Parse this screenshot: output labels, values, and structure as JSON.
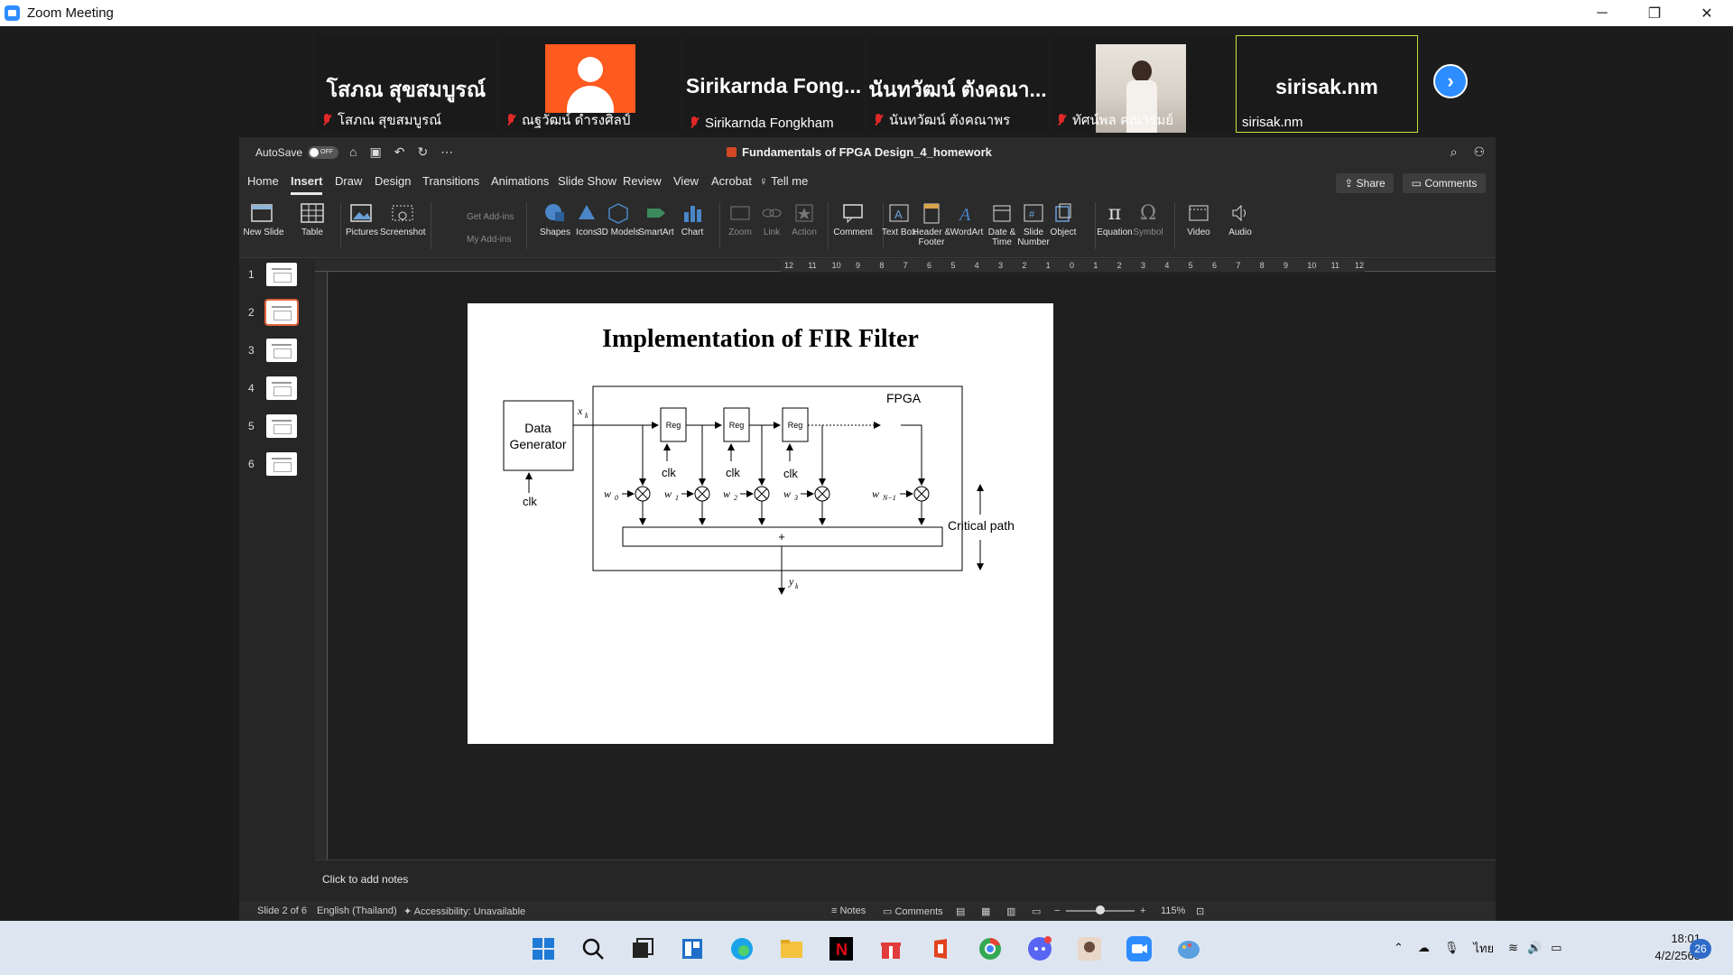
{
  "window": {
    "title": "Zoom Meeting",
    "controls": [
      "─",
      "❐",
      "✕"
    ]
  },
  "participants": [
    {
      "big_name": "โสภณ สุขสมบูรณ์",
      "caption": "โสภณ สุขสมบูรณ์",
      "muted": true,
      "kind": "name"
    },
    {
      "big_name": "",
      "caption": "ณฐวัฒน์ ดำรงศิลป์",
      "muted": true,
      "kind": "avatar"
    },
    {
      "big_name": "Sirikarnda Fong...",
      "caption": "Sirikarnda Fongkham",
      "muted": true,
      "kind": "name"
    },
    {
      "big_name": "นันทวัฒน์ ตังคณา...",
      "caption": "นันทวัฒน์ ตังคณาพร",
      "muted": true,
      "kind": "name"
    },
    {
      "big_name": "",
      "caption": "ทัศน์พล คณารมย์",
      "muted": true,
      "kind": "photo"
    },
    {
      "big_name": "sirisak.nm",
      "caption": "sirisak.nm",
      "muted": false,
      "kind": "name",
      "active": true
    }
  ],
  "ppt": {
    "autosave_label": "AutoSave",
    "autosave_state": "OFF",
    "doc_title": "Fundamentals of FPGA Design_4_homework",
    "tabs": [
      "Home",
      "Insert",
      "Draw",
      "Design",
      "Transitions",
      "Animations",
      "Slide Show",
      "Review",
      "View",
      "Acrobat",
      "Tell me"
    ],
    "active_tab": "Insert",
    "share_label": "Share",
    "comments_label": "Comments",
    "ribbon": {
      "new_slide": "New Slide",
      "table": "Table",
      "pictures": "Pictures",
      "screenshot": "Screenshot",
      "get_addins": "Get Add-ins",
      "my_addins": "My Add-ins",
      "shapes": "Shapes",
      "icons": "Icons",
      "models": "3D Models",
      "smartart": "SmartArt",
      "chart": "Chart",
      "zoom": "Zoom",
      "link": "Link",
      "action": "Action",
      "comment": "Comment",
      "textbox": "Text Box",
      "header_footer": "Header & Footer",
      "wordart": "WordArt",
      "date_time": "Date & Time",
      "slide_number": "Slide Number",
      "object": "Object",
      "equation": "Equation",
      "symbol": "Symbol",
      "video": "Video",
      "audio": "Audio"
    },
    "slides": [
      "1",
      "2",
      "3",
      "4",
      "5",
      "6"
    ],
    "selected_slide": "2",
    "ruler_top": [
      "12",
      "11",
      "10",
      "9",
      "8",
      "7",
      "6",
      "5",
      "4",
      "3",
      "2",
      "1",
      "0",
      "1",
      "2",
      "3",
      "4",
      "5",
      "6",
      "7",
      "8",
      "9",
      "10",
      "11",
      "12"
    ],
    "notes_placeholder": "Click to add notes",
    "status": {
      "slide_of": "Slide 2 of 6",
      "language": "English (Thailand)",
      "accessibility": "Accessibility: Unavailable",
      "notes": "Notes",
      "comments": "Comments",
      "zoom": "115%"
    }
  },
  "slide": {
    "title": "Implementation of FIR Filter",
    "fpga_label": "FPGA",
    "data_generator": [
      "Data",
      "Generator"
    ],
    "clk": "clk",
    "reg": "Reg",
    "xk": "x",
    "xk_sub": "k",
    "weights": [
      {
        "w": "w",
        "sub": "0"
      },
      {
        "w": "w",
        "sub": "1"
      },
      {
        "w": "w",
        "sub": "2"
      },
      {
        "w": "w",
        "sub": "3"
      },
      {
        "w": "w",
        "sub": "N−1"
      }
    ],
    "sum": "+",
    "yk": "y",
    "yk_sub": "k",
    "critical_path": "Critical path"
  },
  "taskbar": {
    "lang": "ไทย",
    "time": "18:01",
    "date": "4/2/2565",
    "notifications": "26"
  }
}
